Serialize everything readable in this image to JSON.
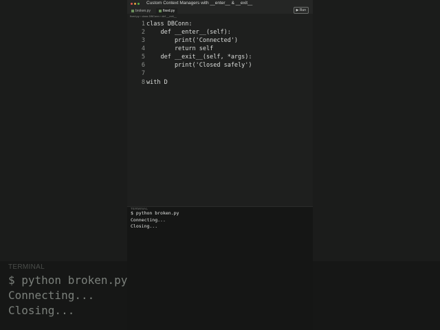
{
  "window": {
    "title": "Custom Context Managers with __enter__ & __exit__",
    "dot_colors": [
      "#e05a4f",
      "#e0a23d",
      "#58b34a"
    ]
  },
  "tabs": [
    {
      "label": "broken.py",
      "active": false
    },
    {
      "label": "fixed.py",
      "active": true
    }
  ],
  "toolbar": {
    "run_label": "▶ Run"
  },
  "breadcrumb": "fixed.py › class DBConn › def __exit__",
  "editor": {
    "lines": [
      {
        "n": "1",
        "text": "class DBConn:"
      },
      {
        "n": "2",
        "text": "    def __enter__(self):"
      },
      {
        "n": "3",
        "text": "        print('Connected')"
      },
      {
        "n": "4",
        "text": "        return self"
      },
      {
        "n": "5",
        "text": "    def __exit__(self, *args):"
      },
      {
        "n": "6",
        "text": "        print('Closed safely')"
      },
      {
        "n": "7",
        "text": ""
      },
      {
        "n": "8",
        "text": "with D"
      }
    ]
  },
  "terminal": {
    "label": "TERMINAL",
    "lines": [
      "$ python broken.py",
      "Connecting...",
      "Closing..."
    ]
  }
}
